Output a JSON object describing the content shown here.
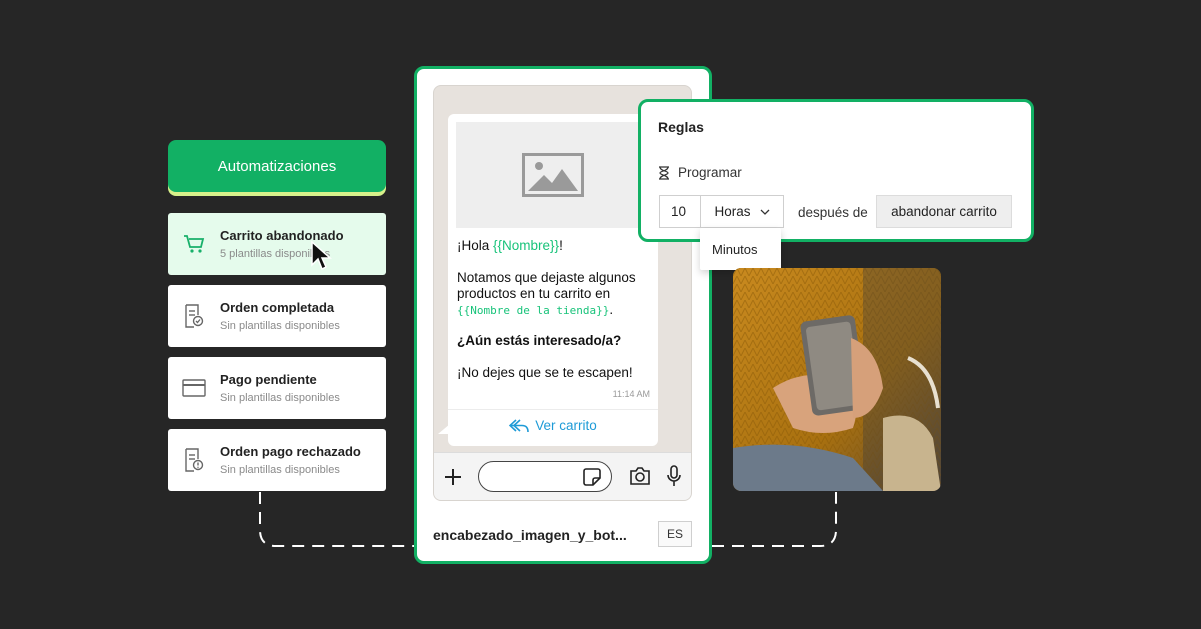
{
  "automations": {
    "header": "Automatizaciones",
    "items": [
      {
        "title": "Carrito abandonado",
        "subtitle": "5 plantillas disponibles",
        "icon": "cart-icon",
        "active": true
      },
      {
        "title": "Orden completada",
        "subtitle": "Sin plantillas disponibles",
        "icon": "receipt-check-icon",
        "active": false
      },
      {
        "title": "Pago pendiente",
        "subtitle": "Sin plantillas disponibles",
        "icon": "card-icon",
        "active": false
      },
      {
        "title": "Orden pago rechazado",
        "subtitle": "Sin plantillas disponibles",
        "icon": "receipt-alert-icon",
        "active": false
      }
    ]
  },
  "message": {
    "greeting_prefix": "¡Hola ",
    "name_var": "{{Nombre}}",
    "greeting_suffix": "!",
    "line1": "Notamos que dejaste algunos productos en tu carrito en",
    "store_var": "{{Nombre de la tienda}}",
    "store_suffix": ".",
    "question": "¿Aún estás interesado/a?",
    "closing": "¡No dejes que se te escapen!",
    "time": "11:14 AM",
    "cta": "Ver carrito"
  },
  "template": {
    "name": "encabezado_imagen_y_bot...",
    "language": "ES"
  },
  "rules": {
    "title": "Reglas",
    "schedule_label": "Programar",
    "amount": "10",
    "unit": "Horas",
    "after_label": "después de",
    "event": "abandonar carrito",
    "dropdown_option": "Minutos"
  },
  "colors": {
    "accent": "#12b064",
    "background": "#262626",
    "variable": "#18c37a",
    "link": "#1e9bd7"
  }
}
